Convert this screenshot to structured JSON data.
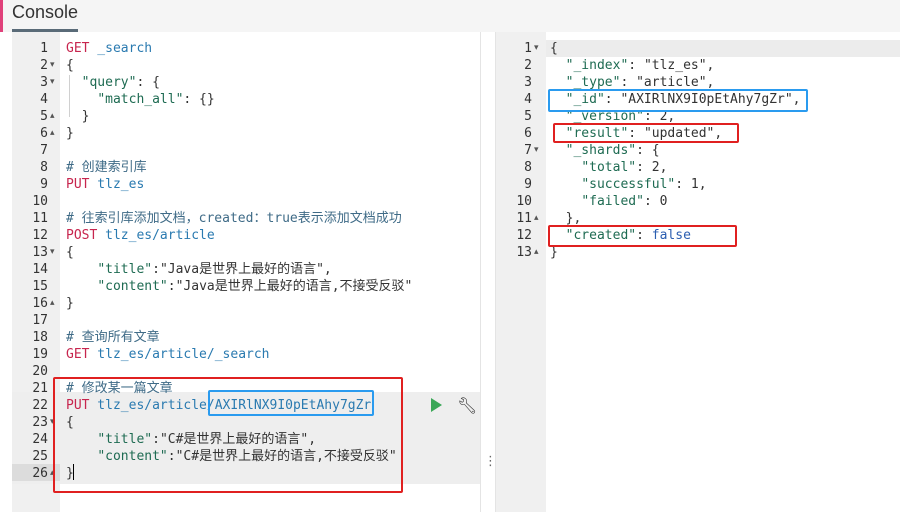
{
  "tab": {
    "label": "Console"
  },
  "request_lines": [
    {
      "n": "1",
      "fold": "",
      "segments": [
        {
          "c": "method",
          "t": "GET"
        },
        {
          "c": "url",
          "t": " _search"
        }
      ]
    },
    {
      "n": "2",
      "fold": "▾",
      "segments": [
        {
          "c": "brace",
          "t": "{"
        }
      ]
    },
    {
      "n": "3",
      "fold": "▾",
      "segments": [
        {
          "c": "ws",
          "t": "  "
        },
        {
          "c": "key",
          "t": "\"query\""
        },
        {
          "c": "brace",
          "t": ": {"
        }
      ]
    },
    {
      "n": "4",
      "fold": "",
      "segments": [
        {
          "c": "ws",
          "t": "    "
        },
        {
          "c": "key",
          "t": "\"match_all\""
        },
        {
          "c": "brace",
          "t": ": {}"
        }
      ]
    },
    {
      "n": "5",
      "fold": "▴",
      "segments": [
        {
          "c": "ws",
          "t": "  "
        },
        {
          "c": "brace",
          "t": "}"
        }
      ]
    },
    {
      "n": "6",
      "fold": "▴",
      "segments": [
        {
          "c": "brace",
          "t": "}"
        }
      ]
    },
    {
      "n": "7",
      "fold": "",
      "segments": []
    },
    {
      "n": "8",
      "fold": "",
      "segments": [
        {
          "c": "comment",
          "t": "# 创建索引库"
        }
      ]
    },
    {
      "n": "9",
      "fold": "",
      "segments": [
        {
          "c": "method",
          "t": "PUT"
        },
        {
          "c": "url",
          "t": " tlz_es"
        }
      ]
    },
    {
      "n": "10",
      "fold": "",
      "segments": []
    },
    {
      "n": "11",
      "fold": "",
      "segments": [
        {
          "c": "comment",
          "t": "# 往索引库添加文档，created：true表示添加文档成功"
        }
      ]
    },
    {
      "n": "12",
      "fold": "",
      "segments": [
        {
          "c": "method",
          "t": "POST"
        },
        {
          "c": "url",
          "t": " tlz_es/article"
        }
      ]
    },
    {
      "n": "13",
      "fold": "▾",
      "segments": [
        {
          "c": "brace",
          "t": "{"
        }
      ]
    },
    {
      "n": "14",
      "fold": "",
      "segments": [
        {
          "c": "ws",
          "t": "    "
        },
        {
          "c": "key",
          "t": "\"title\""
        },
        {
          "c": "brace",
          "t": ":"
        },
        {
          "c": "str",
          "t": "\"Java是世界上最好的语言\","
        }
      ]
    },
    {
      "n": "15",
      "fold": "",
      "segments": [
        {
          "c": "ws",
          "t": "    "
        },
        {
          "c": "key",
          "t": "\"content\""
        },
        {
          "c": "brace",
          "t": ":"
        },
        {
          "c": "str",
          "t": "\"Java是世界上最好的语言,不接受反驳\""
        }
      ]
    },
    {
      "n": "16",
      "fold": "▴",
      "segments": [
        {
          "c": "brace",
          "t": "}"
        }
      ]
    },
    {
      "n": "17",
      "fold": "",
      "segments": []
    },
    {
      "n": "18",
      "fold": "",
      "segments": [
        {
          "c": "comment",
          "t": "# 查询所有文章"
        }
      ]
    },
    {
      "n": "19",
      "fold": "",
      "segments": [
        {
          "c": "method",
          "t": "GET"
        },
        {
          "c": "url",
          "t": " tlz_es/article/_search"
        }
      ]
    },
    {
      "n": "20",
      "fold": "",
      "segments": []
    },
    {
      "n": "21",
      "fold": "",
      "segments": [
        {
          "c": "comment",
          "t": "# 修改某一篇文章"
        }
      ]
    },
    {
      "n": "22",
      "fold": "",
      "segments": [
        {
          "c": "method",
          "t": "PUT"
        },
        {
          "c": "url",
          "t": " tlz_es/article/AXIRlNX9I0pEtAhy7gZr"
        }
      ]
    },
    {
      "n": "23",
      "fold": "▾",
      "segments": [
        {
          "c": "brace",
          "t": "{"
        }
      ]
    },
    {
      "n": "24",
      "fold": "",
      "segments": [
        {
          "c": "ws",
          "t": "    "
        },
        {
          "c": "key",
          "t": "\"title\""
        },
        {
          "c": "brace",
          "t": ":"
        },
        {
          "c": "str",
          "t": "\"C#是世界上最好的语言\","
        }
      ]
    },
    {
      "n": "25",
      "fold": "",
      "segments": [
        {
          "c": "ws",
          "t": "    "
        },
        {
          "c": "key",
          "t": "\"content\""
        },
        {
          "c": "brace",
          "t": ":"
        },
        {
          "c": "str",
          "t": "\"C#是世界上最好的语言,不接受反驳\""
        }
      ]
    },
    {
      "n": "26",
      "fold": "▴",
      "segments": [
        {
          "c": "brace",
          "t": "}"
        }
      ]
    }
  ],
  "response_lines": [
    {
      "n": "1",
      "fold": "▾",
      "segments": [
        {
          "c": "brace",
          "t": "{"
        }
      ]
    },
    {
      "n": "2",
      "fold": "",
      "segments": [
        {
          "c": "ws",
          "t": "  "
        },
        {
          "c": "key",
          "t": "\"_index\""
        },
        {
          "c": "brace",
          "t": ": "
        },
        {
          "c": "str",
          "t": "\"tlz_es\","
        }
      ]
    },
    {
      "n": "3",
      "fold": "",
      "segments": [
        {
          "c": "ws",
          "t": "  "
        },
        {
          "c": "key",
          "t": "\"_type\""
        },
        {
          "c": "brace",
          "t": ": "
        },
        {
          "c": "str",
          "t": "\"article\","
        }
      ]
    },
    {
      "n": "4",
      "fold": "",
      "segments": [
        {
          "c": "ws",
          "t": "  "
        },
        {
          "c": "key",
          "t": "\"_id\""
        },
        {
          "c": "brace",
          "t": ": "
        },
        {
          "c": "str",
          "t": "\"AXIRlNX9I0pEtAhy7gZr\","
        }
      ]
    },
    {
      "n": "5",
      "fold": "",
      "segments": [
        {
          "c": "ws",
          "t": "  "
        },
        {
          "c": "key",
          "t": "\"_version\""
        },
        {
          "c": "brace",
          "t": ": "
        },
        {
          "c": "num",
          "t": "2,"
        }
      ]
    },
    {
      "n": "6",
      "fold": "",
      "segments": [
        {
          "c": "ws",
          "t": "  "
        },
        {
          "c": "key",
          "t": "\"result\""
        },
        {
          "c": "brace",
          "t": ": "
        },
        {
          "c": "str",
          "t": "\"updated\","
        }
      ]
    },
    {
      "n": "7",
      "fold": "▾",
      "segments": [
        {
          "c": "ws",
          "t": "  "
        },
        {
          "c": "key",
          "t": "\"_shards\""
        },
        {
          "c": "brace",
          "t": ": {"
        }
      ]
    },
    {
      "n": "8",
      "fold": "",
      "segments": [
        {
          "c": "ws",
          "t": "    "
        },
        {
          "c": "key",
          "t": "\"total\""
        },
        {
          "c": "brace",
          "t": ": "
        },
        {
          "c": "num",
          "t": "2,"
        }
      ]
    },
    {
      "n": "9",
      "fold": "",
      "segments": [
        {
          "c": "ws",
          "t": "    "
        },
        {
          "c": "key",
          "t": "\"successful\""
        },
        {
          "c": "brace",
          "t": ": "
        },
        {
          "c": "num",
          "t": "1,"
        }
      ]
    },
    {
      "n": "10",
      "fold": "",
      "segments": [
        {
          "c": "ws",
          "t": "    "
        },
        {
          "c": "key",
          "t": "\"failed\""
        },
        {
          "c": "brace",
          "t": ": "
        },
        {
          "c": "num",
          "t": "0"
        }
      ]
    },
    {
      "n": "11",
      "fold": "▴",
      "segments": [
        {
          "c": "ws",
          "t": "  "
        },
        {
          "c": "brace",
          "t": "},"
        }
      ]
    },
    {
      "n": "12",
      "fold": "",
      "segments": [
        {
          "c": "ws",
          "t": "  "
        },
        {
          "c": "key",
          "t": "\"created\""
        },
        {
          "c": "brace",
          "t": ": "
        },
        {
          "c": "bool",
          "t": "false"
        }
      ]
    },
    {
      "n": "13",
      "fold": "▴",
      "segments": [
        {
          "c": "brace",
          "t": "}"
        }
      ]
    }
  ],
  "icons": {
    "play": "play-icon",
    "wrench": "wrench-icon",
    "resize": "vertical-dots-icon"
  },
  "colors": {
    "method": "#c7254e",
    "url": "#2a7ab0",
    "play": "#3aa757",
    "annotation_red": "#e02020",
    "annotation_blue": "#2a9bef"
  }
}
